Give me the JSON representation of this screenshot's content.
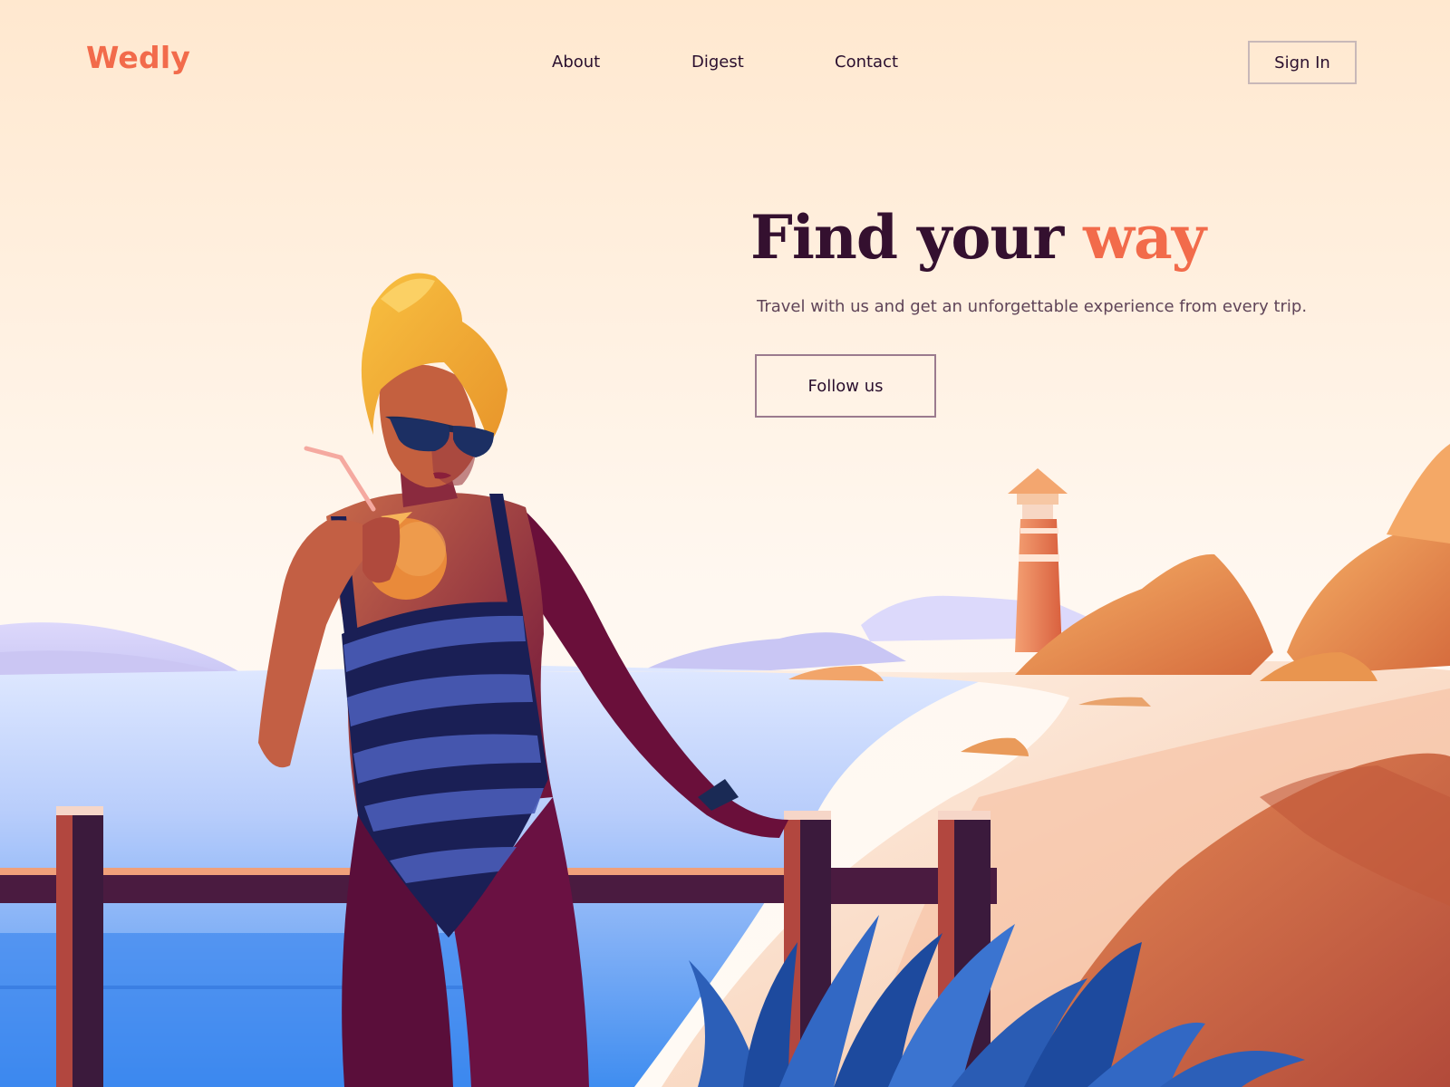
{
  "header": {
    "logo": "Wedly",
    "nav": [
      {
        "label": "About"
      },
      {
        "label": "Digest"
      },
      {
        "label": "Contact"
      }
    ],
    "sign_in_label": "Sign In"
  },
  "hero": {
    "title_main": "Find your",
    "title_accent": "way",
    "subtitle": "Travel with us and get an unforgettable experience from every trip.",
    "cta_label": "Follow us"
  },
  "colors": {
    "accent": "#f26b4b",
    "heading": "#34102f",
    "text": "#2a0f2e",
    "sea": "#3f8df0",
    "sand": "#f6c1a0"
  }
}
